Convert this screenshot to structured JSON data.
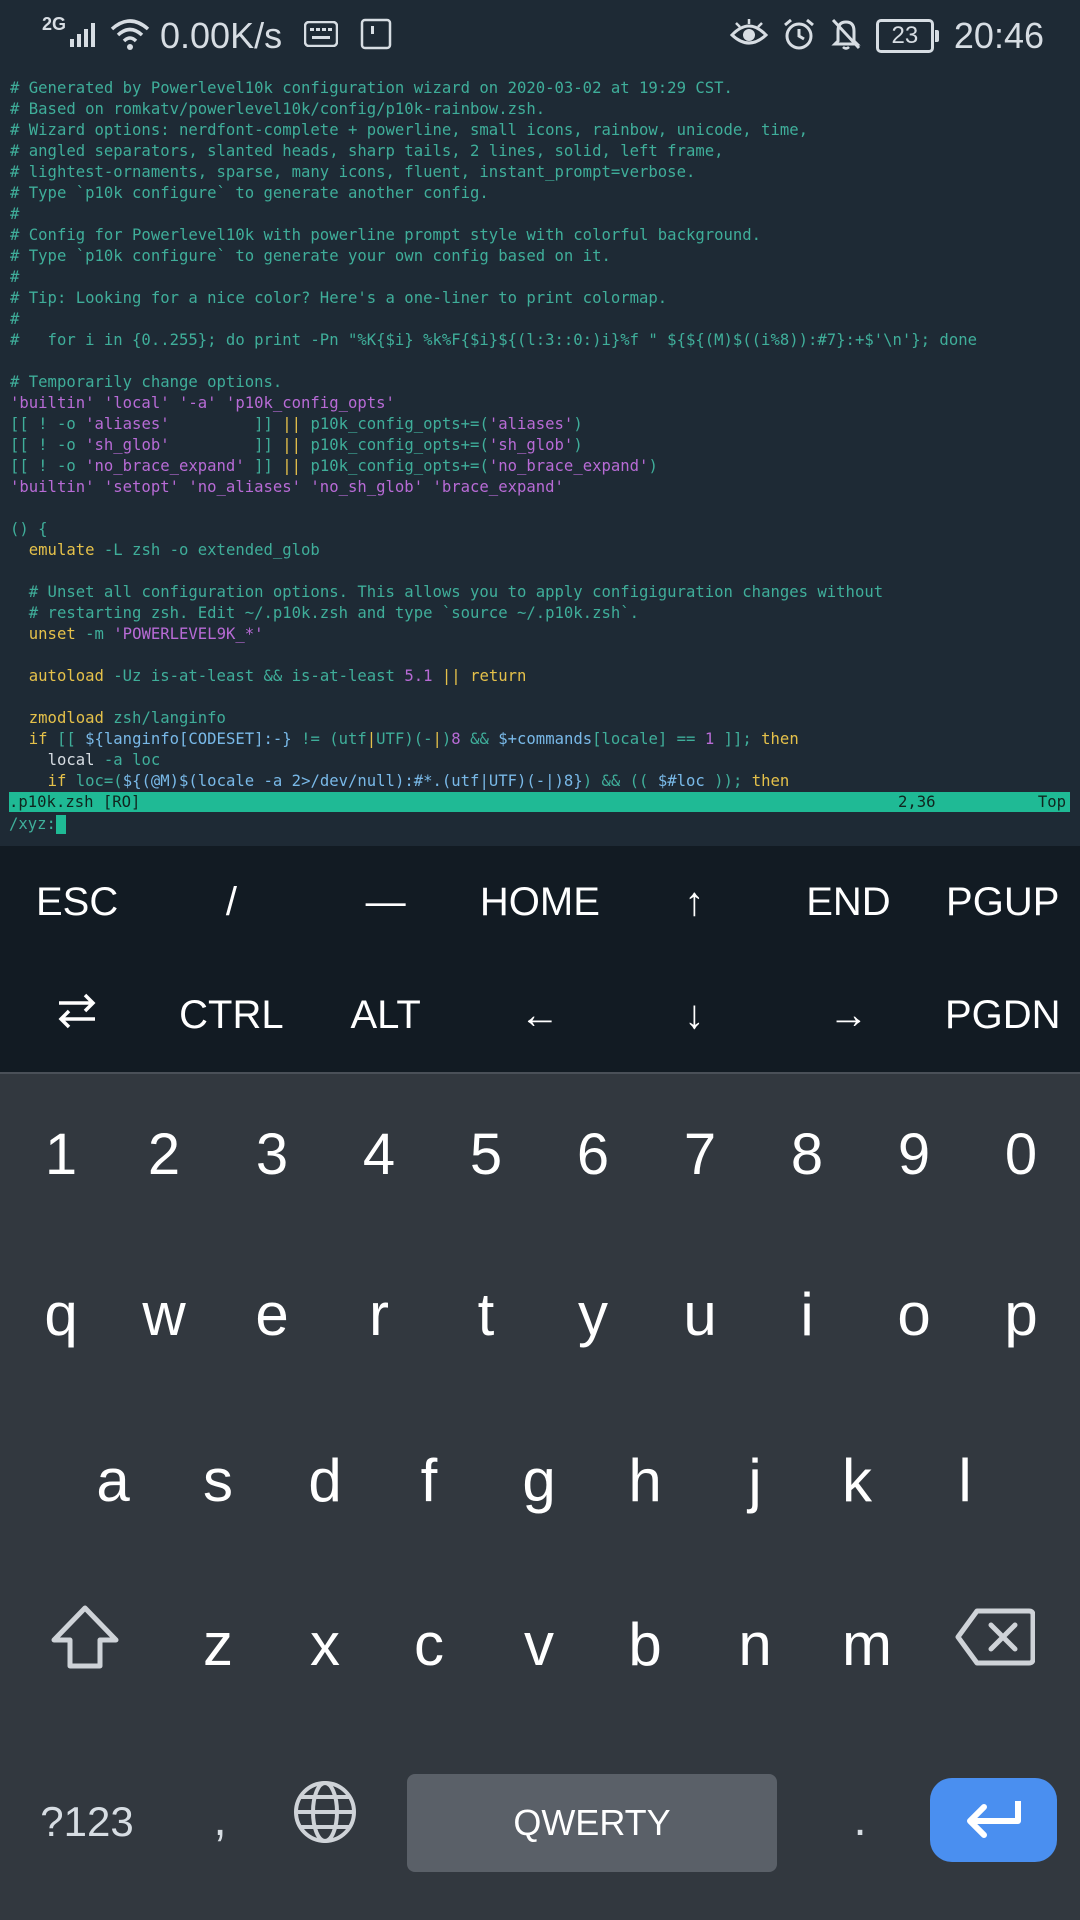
{
  "status_bar": {
    "network_gen": "2G",
    "speed": "0.00K/s",
    "battery": "23",
    "time": "20:46",
    "icons": [
      "signal-icon",
      "wifi-icon",
      "keyboard-icon",
      "sim-icon",
      "eye-icon",
      "alarm-icon",
      "bell-off-icon",
      "battery-icon"
    ]
  },
  "editor": {
    "file_status": ".p10k.zsh [RO]",
    "cursor_pos": "2,36",
    "scroll_pos": "Top",
    "command_line": "/xyz:"
  },
  "extra_keys": {
    "row1": [
      "ESC",
      "/",
      "—",
      "HOME",
      "↑",
      "END",
      "PGUP"
    ],
    "row2": [
      "⇄",
      "CTRL",
      "ALT",
      "←",
      "↓",
      "→",
      "PGDN"
    ]
  },
  "keyboard": {
    "numbers": [
      "1",
      "2",
      "3",
      "4",
      "5",
      "6",
      "7",
      "8",
      "9",
      "0"
    ],
    "row_q": [
      "q",
      "w",
      "e",
      "r",
      "t",
      "y",
      "u",
      "i",
      "o",
      "p"
    ],
    "row_a": [
      "a",
      "s",
      "d",
      "f",
      "g",
      "h",
      "j",
      "k",
      "l"
    ],
    "row_z": [
      "z",
      "x",
      "c",
      "v",
      "b",
      "n",
      "m"
    ],
    "symbols_label": "?123",
    "comma": ",",
    "period": ".",
    "space_label": "QWERTY"
  },
  "colors": {
    "comment": "#3fae9a",
    "string": "#b86bd6",
    "keyword": "#e5c14a",
    "variable": "#79b9e8",
    "statusline_bg": "#1fba95",
    "enter_key": "#4a8ff0"
  }
}
